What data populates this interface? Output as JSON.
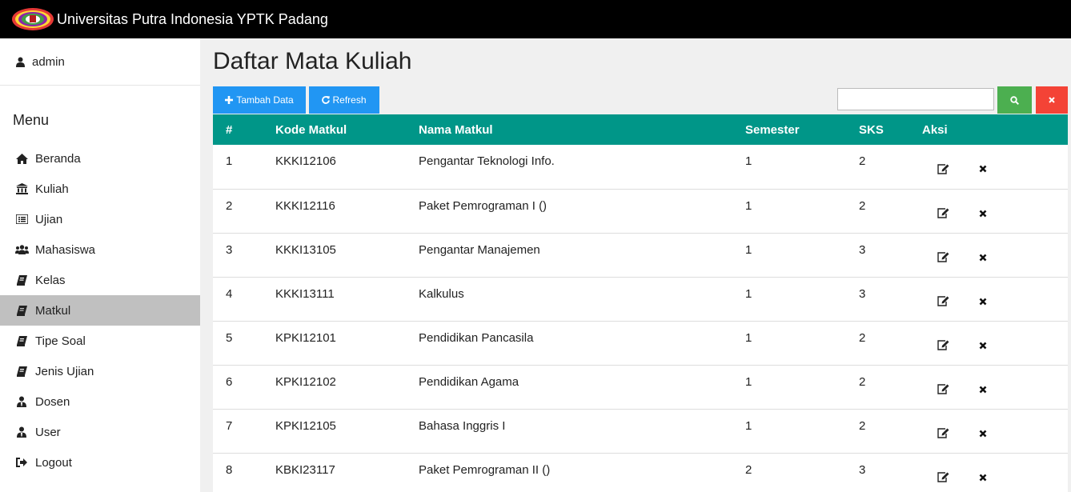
{
  "header": {
    "title": "Universitas Putra Indonesia YPTK Padang"
  },
  "sidebar": {
    "user": "admin",
    "menu_title": "Menu",
    "items": [
      {
        "label": "Beranda",
        "icon": "home-icon"
      },
      {
        "label": "Kuliah",
        "icon": "bank-icon"
      },
      {
        "label": "Ujian",
        "icon": "list-icon"
      },
      {
        "label": "Mahasiswa",
        "icon": "users-icon"
      },
      {
        "label": "Kelas",
        "icon": "book-icon"
      },
      {
        "label": "Matkul",
        "icon": "book-icon",
        "active": true
      },
      {
        "label": "Tipe Soal",
        "icon": "book-icon"
      },
      {
        "label": "Jenis Ujian",
        "icon": "book-icon"
      },
      {
        "label": "Dosen",
        "icon": "user-tie-icon"
      },
      {
        "label": "User",
        "icon": "user-tie-icon"
      },
      {
        "label": "Logout",
        "icon": "logout-icon"
      }
    ]
  },
  "main": {
    "title": "Daftar Mata Kuliah",
    "add_label": "Tambah Data",
    "refresh_label": "Refresh",
    "search_value": "",
    "colors": {
      "primary": "#2196f3",
      "success": "#4caf50",
      "danger": "#f44336",
      "table_header": "#009688"
    }
  },
  "table": {
    "headers": [
      "#",
      "Kode Matkul",
      "Nama Matkul",
      "Semester",
      "SKS",
      "Aksi"
    ],
    "rows": [
      [
        "1",
        "KKKI12106",
        "Pengantar Teknologi Info.",
        "1",
        "2"
      ],
      [
        "2",
        "KKKI12116",
        "Paket Pemrograman I ()",
        "1",
        "2"
      ],
      [
        "3",
        "KKKI13105",
        "Pengantar Manajemen",
        "1",
        "3"
      ],
      [
        "4",
        "KKKI13111",
        "Kalkulus",
        "1",
        "3"
      ],
      [
        "5",
        "KPKI12101",
        "Pendidikan Pancasila",
        "1",
        "2"
      ],
      [
        "6",
        "KPKI12102",
        "Pendidikan Agama",
        "1",
        "2"
      ],
      [
        "7",
        "KPKI12105",
        "Bahasa Inggris I",
        "1",
        "2"
      ],
      [
        "8",
        "KBKI23117",
        "Paket Pemrograman II ()",
        "2",
        "3"
      ]
    ]
  }
}
